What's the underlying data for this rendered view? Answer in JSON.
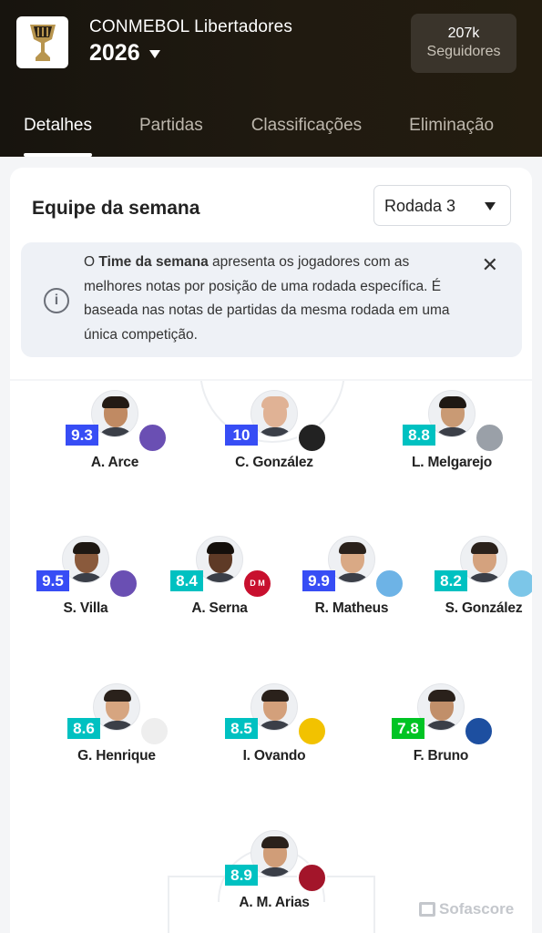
{
  "header": {
    "competition": "CONMEBOL Libertadores",
    "season": "2026",
    "followers_count": "207k",
    "followers_label": "Seguidores"
  },
  "tabs": [
    {
      "label": "Detalhes",
      "active": true
    },
    {
      "label": "Partidas",
      "active": false
    },
    {
      "label": "Classificações",
      "active": false
    },
    {
      "label": "Eliminação",
      "active": false
    }
  ],
  "card": {
    "title": "Equipe da semana",
    "round": "Rodada 3",
    "info_prefix": "O ",
    "info_bold": "Time da semana",
    "info_rest": " apresenta os jogadores com as melhores notas por posição de uma rodada específica. É baseada nas notas de partidas da mesma rodada em uma única competição.",
    "close_glyph": "✕",
    "info_glyph": "i"
  },
  "watermark": "Sofascore",
  "players": [
    {
      "name": "A. Arce",
      "rating": "9.3",
      "rating_color": "#374df5",
      "badge_color": "#6a4fb3",
      "badge_text": "",
      "skin": "#c08a63",
      "hair": "#231a14"
    },
    {
      "name": "C. González",
      "rating": "10",
      "rating_color": "#374df5",
      "badge_color": "#222222",
      "badge_text": "",
      "skin": "#e0b295",
      "hair": "#e0b295"
    },
    {
      "name": "L. Melgarejo",
      "rating": "8.8",
      "rating_color": "#00c1c1",
      "badge_color": "#9aa0a8",
      "badge_text": "",
      "skin": "#c99a74",
      "hair": "#1e1813"
    },
    {
      "name": "S. Villa",
      "rating": "9.5",
      "rating_color": "#374df5",
      "badge_color": "#6a4fb3",
      "badge_text": "",
      "skin": "#8a5a3c",
      "hair": "#1e1813"
    },
    {
      "name": "A. Serna",
      "rating": "8.4",
      "rating_color": "#00c1c1",
      "badge_color": "#c8102e",
      "badge_text": "D M",
      "skin": "#5e3a26",
      "hair": "#140f0b"
    },
    {
      "name": "R. Matheus",
      "rating": "9.9",
      "rating_color": "#374df5",
      "badge_color": "#6db3e6",
      "badge_text": "",
      "skin": "#d9a985",
      "hair": "#2a211b"
    },
    {
      "name": "S. González",
      "rating": "8.2",
      "rating_color": "#00c1c1",
      "badge_color": "#7cc6e8",
      "badge_text": "",
      "skin": "#d4a27e",
      "hair": "#2a211b"
    },
    {
      "name": "G. Henrique",
      "rating": "8.6",
      "rating_color": "#00c1c1",
      "badge_color": "#eeeeee",
      "badge_text": "",
      "skin": "#d6a580",
      "hair": "#2a211b"
    },
    {
      "name": "I. Ovando",
      "rating": "8.5",
      "rating_color": "#00c1c1",
      "badge_color": "#f2c200",
      "badge_text": "",
      "skin": "#d3a07b",
      "hair": "#2a211b"
    },
    {
      "name": "F. Bruno",
      "rating": "7.8",
      "rating_color": "#00c424",
      "badge_color": "#1d4fa0",
      "badge_text": "",
      "skin": "#c18f6a",
      "hair": "#2a211b"
    },
    {
      "name": "A. M. Arias",
      "rating": "8.9",
      "rating_color": "#00c1c1",
      "badge_color": "#a3152a",
      "badge_text": "",
      "skin": "#d09d78",
      "hair": "#2a211b"
    }
  ]
}
